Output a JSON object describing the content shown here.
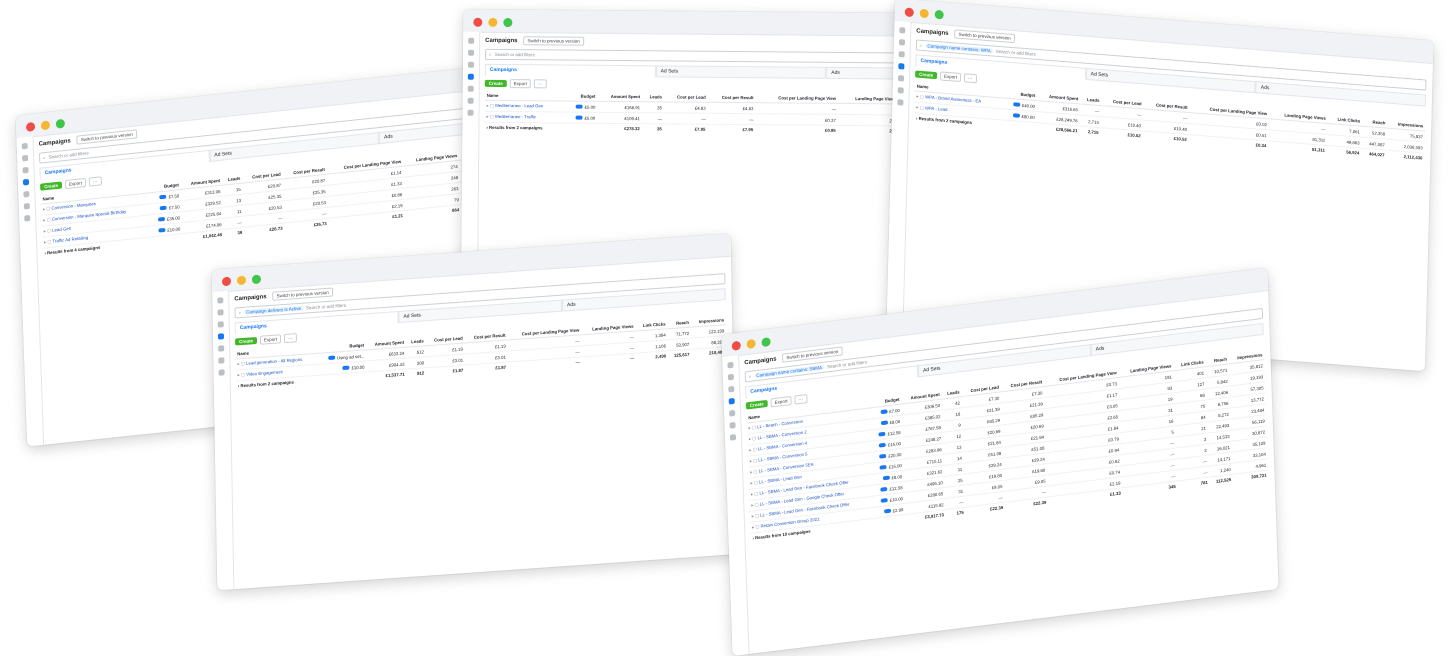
{
  "windows": [
    {
      "title": "Campaigns",
      "switch_label": "Switch to previous version",
      "search_placeholder": "Search or add filters",
      "filter_chip": "",
      "tabs": [
        "Campaigns",
        "Ad Sets",
        "Ads"
      ],
      "create_label": "Create",
      "export_label": "Export",
      "columns": [
        "Name",
        "Budget",
        "Amount Spent",
        "Leads",
        "Cost per Lead",
        "Cost per Result",
        "Cost per Landing Page View",
        "Landing Page Views",
        "Link Clicks",
        "Reach",
        "Impressions"
      ],
      "rows": [
        {
          "name": "Conversion - Marquees",
          "values": [
            "£7.50",
            "£313.06",
            "15",
            "£20.87",
            "£20.87",
            "£1.14",
            "274",
            "584",
            "8,141",
            "41,672"
          ]
        },
        {
          "name": "Conversion - Marquee Special Birthday",
          "values": [
            "£7.50",
            "£329.52",
            "13",
            "£25.35",
            "£25.35",
            "£1.33",
            "248",
            "531",
            "9,064",
            "34,111"
          ]
        },
        {
          "name": "Lead Gen",
          "values": [
            "£35.00",
            "£225.84",
            "11",
            "£20.53",
            "£20.53",
            "£0.86",
            "263",
            "507",
            "8,962",
            "32,114"
          ]
        },
        {
          "name": "Traffic Ad Retailing",
          "values": [
            "£10.00",
            "£174.06",
            "—",
            "—",
            "—",
            "£2.19",
            "79",
            "278",
            "4,291",
            "17,891"
          ]
        }
      ],
      "total_label": "Results from 4 campaigns",
      "totals": [
        "",
        "£1,042.48",
        "39",
        "£26.73",
        "£26.73",
        "£1.21",
        "864",
        "1,900",
        "23,508",
        "125,788"
      ]
    },
    {
      "title": "Campaigns",
      "switch_label": "Switch to previous version",
      "search_placeholder": "Search or add filters",
      "filter_chip": "",
      "tabs": [
        "Campaigns",
        "Ad Sets",
        "Ads"
      ],
      "create_label": "Create",
      "export_label": "Export",
      "columns": [
        "Name",
        "Budget",
        "Amount Spent",
        "Leads",
        "Cost per Lead",
        "Cost per Result",
        "Cost per Landing Page View",
        "Landing Page Views",
        "Link Clicks",
        "Reach",
        "Impressions"
      ],
      "rows": [
        {
          "name": "Mediterraneo - Lead Gen",
          "values": [
            "£5.00",
            "£168.91",
            "35",
            "£4.83",
            "£4.83",
            "—",
            "—",
            "182",
            "22,557",
            "41,904"
          ]
        },
        {
          "name": "Mediterraneo - Traffic",
          "values": [
            "£5.00",
            "£109.41",
            "—",
            "—",
            "—",
            "£0.37",
            "293",
            "423",
            "61,872",
            "98,417"
          ]
        }
      ],
      "total_label": "Results from 2 campaigns",
      "totals": [
        "",
        "£278.32",
        "35",
        "£7.95",
        "£7.95",
        "£0.95",
        "293",
        "605",
        "80,151",
        "140,321"
      ]
    },
    {
      "title": "Campaigns",
      "switch_label": "Switch to previous version",
      "search_placeholder": "Search or add filters",
      "filter_chip": "Campaign name contains: WPA",
      "tabs": [
        "Campaigns",
        "Ad Sets",
        "Ads"
      ],
      "create_label": "Create",
      "export_label": "Export",
      "columns": [
        "Name",
        "Budget",
        "Amount Spent",
        "Leads",
        "Cost per Lead",
        "Cost per Result",
        "Cost per Landing Page View",
        "Landing Page Views",
        "Link Clicks",
        "Reach",
        "Impressions"
      ],
      "rows": [
        {
          "name": "WPA - Brand Awareness - EA",
          "values": [
            "£40.00",
            "£316.65",
            "—",
            "—",
            "—",
            "£0.02",
            "—",
            "7,061",
            "52,358",
            "75,837"
          ]
        },
        {
          "name": "WPA - Lead",
          "values": [
            "£80.00",
            "£28,249.76",
            "2,715",
            "£10.40",
            "£10.40",
            "£0.51",
            "81,311",
            "49,863",
            "447,087",
            "2,036,593"
          ]
        }
      ],
      "total_label": "Results from 2 campaigns",
      "totals": [
        "",
        "£28,566.21",
        "2,715",
        "£10.52",
        "£10.52",
        "£0.34",
        "81,311",
        "56,924",
        "464,027",
        "2,112,430"
      ]
    },
    {
      "title": "Campaigns",
      "switch_label": "Switch to previous version",
      "search_placeholder": "Search or add filters",
      "filter_chip": "Campaign delivery is Active",
      "tabs": [
        "Campaigns",
        "Ad Sets",
        "Ads"
      ],
      "create_label": "Create",
      "export_label": "Export",
      "columns": [
        "Name",
        "Budget",
        "Amount Spent",
        "Leads",
        "Cost per Lead",
        "Cost per Result",
        "Cost per Landing Page View",
        "Landing Page Views",
        "Link Clicks",
        "Reach",
        "Impressions"
      ],
      "rows": [
        {
          "name": "Lead generation - All Regions",
          "values": [
            "Using ad set...",
            "£633.24",
            "512",
            "£1.19",
            "£1.19",
            "—",
            "—",
            "1,384",
            "71,772",
            "122,199"
          ]
        },
        {
          "name": "Video Engagement",
          "values": [
            "£10.00",
            "£904.43",
            "300",
            "£3.01",
            "£3.01",
            "—",
            "—",
            "1,106",
            "53,907",
            "88,202"
          ]
        }
      ],
      "total_label": "Results from 2 campaigns",
      "totals": [
        "",
        "£1,537.71",
        "812",
        "£1.87",
        "£1.87",
        "—",
        "—",
        "2,490",
        "125,617",
        "210,401"
      ]
    },
    {
      "title": "Campaigns",
      "switch_label": "Switch to previous version",
      "search_placeholder": "Search or add filters",
      "filter_chip": "Campaign name contains: SBMA",
      "tabs": [
        "Campaigns",
        "Ad Sets",
        "Ads"
      ],
      "create_label": "Create",
      "export_label": "Export",
      "columns": [
        "Name",
        "Budget",
        "Amount Spent",
        "Leads",
        "Cost per Lead",
        "Cost per Result",
        "Cost per Landing Page View",
        "Landing Page Views",
        "Link Clicks",
        "Reach",
        "Impressions"
      ],
      "rows": [
        {
          "name": "LL - Beach - Conversion",
          "values": [
            "£7.00",
            "£306.50",
            "42",
            "£7.30",
            "£7.30",
            "£0.73",
            "191",
            "401",
            "10,571",
            "35,812"
          ]
        },
        {
          "name": "LL - SBMA - Conversion 2",
          "values": [
            "£8.00",
            "£385.02",
            "18",
            "£21.39",
            "£21.39",
            "£1.17",
            "83",
            "127",
            "5,842",
            "19,193"
          ]
        },
        {
          "name": "LL - SBMA - Conversion 4",
          "values": [
            "£12.58",
            "£767.58",
            "9",
            "£85.29",
            "£85.29",
            "£3.05",
            "19",
            "68",
            "12,406",
            "57,305"
          ]
        },
        {
          "name": "LL - SBMA - Conversion 5",
          "values": [
            "£15.00",
            "£248.27",
            "12",
            "£20.69",
            "£20.69",
            "£2.65",
            "31",
            "75",
            "6,756",
            "13,772"
          ]
        },
        {
          "name": "LL - SBMA - Conversion 5EA",
          "values": [
            "£20.00",
            "£283.96",
            "13",
            "£21.84",
            "£21.84",
            "£1.84",
            "16",
            "84",
            "8,272",
            "23,484"
          ]
        },
        {
          "name": "LL - SBMA - Lead Gen",
          "values": [
            "£15.00",
            "£715.11",
            "14",
            "£51.08",
            "£51.08",
            "£0.79",
            "5",
            "21",
            "22,493",
            "56,119"
          ]
        },
        {
          "name": "LL - SBMA - Lead Gen - Facebook Check Offer",
          "values": [
            "£8.00",
            "£321.62",
            "11",
            "£29.24",
            "£29.24",
            "£0.94",
            "—",
            "3",
            "14,533",
            "30,872"
          ]
        },
        {
          "name": "LL - SBMA - Lead Gen - Google Check Offer",
          "values": [
            "£12.58",
            "£495.10",
            "25",
            "£19.80",
            "£19.80",
            "£0.62",
            "—",
            "2",
            "16,021",
            "35,109"
          ]
        },
        {
          "name": "LL - SBMA - Lead Gen - Facebook Check Offer",
          "values": [
            "£10.00",
            "£280.65",
            "31",
            "£9.05",
            "£9.05",
            "£0.74",
            "—",
            "—",
            "14,171",
            "33,104"
          ]
        },
        {
          "name": "Retain Conversion Group 2021",
          "values": [
            "£2.99",
            "£115.92",
            "—",
            "—",
            "—",
            "£2.19",
            "—",
            "—",
            "1,240",
            "4,961"
          ]
        }
      ],
      "total_label": "Results from 10 campaigns",
      "totals": [
        "",
        "£3,917.73",
        "175",
        "£22.39",
        "£22.39",
        "£1.33",
        "345",
        "781",
        "112,525",
        "309,721"
      ]
    }
  ]
}
